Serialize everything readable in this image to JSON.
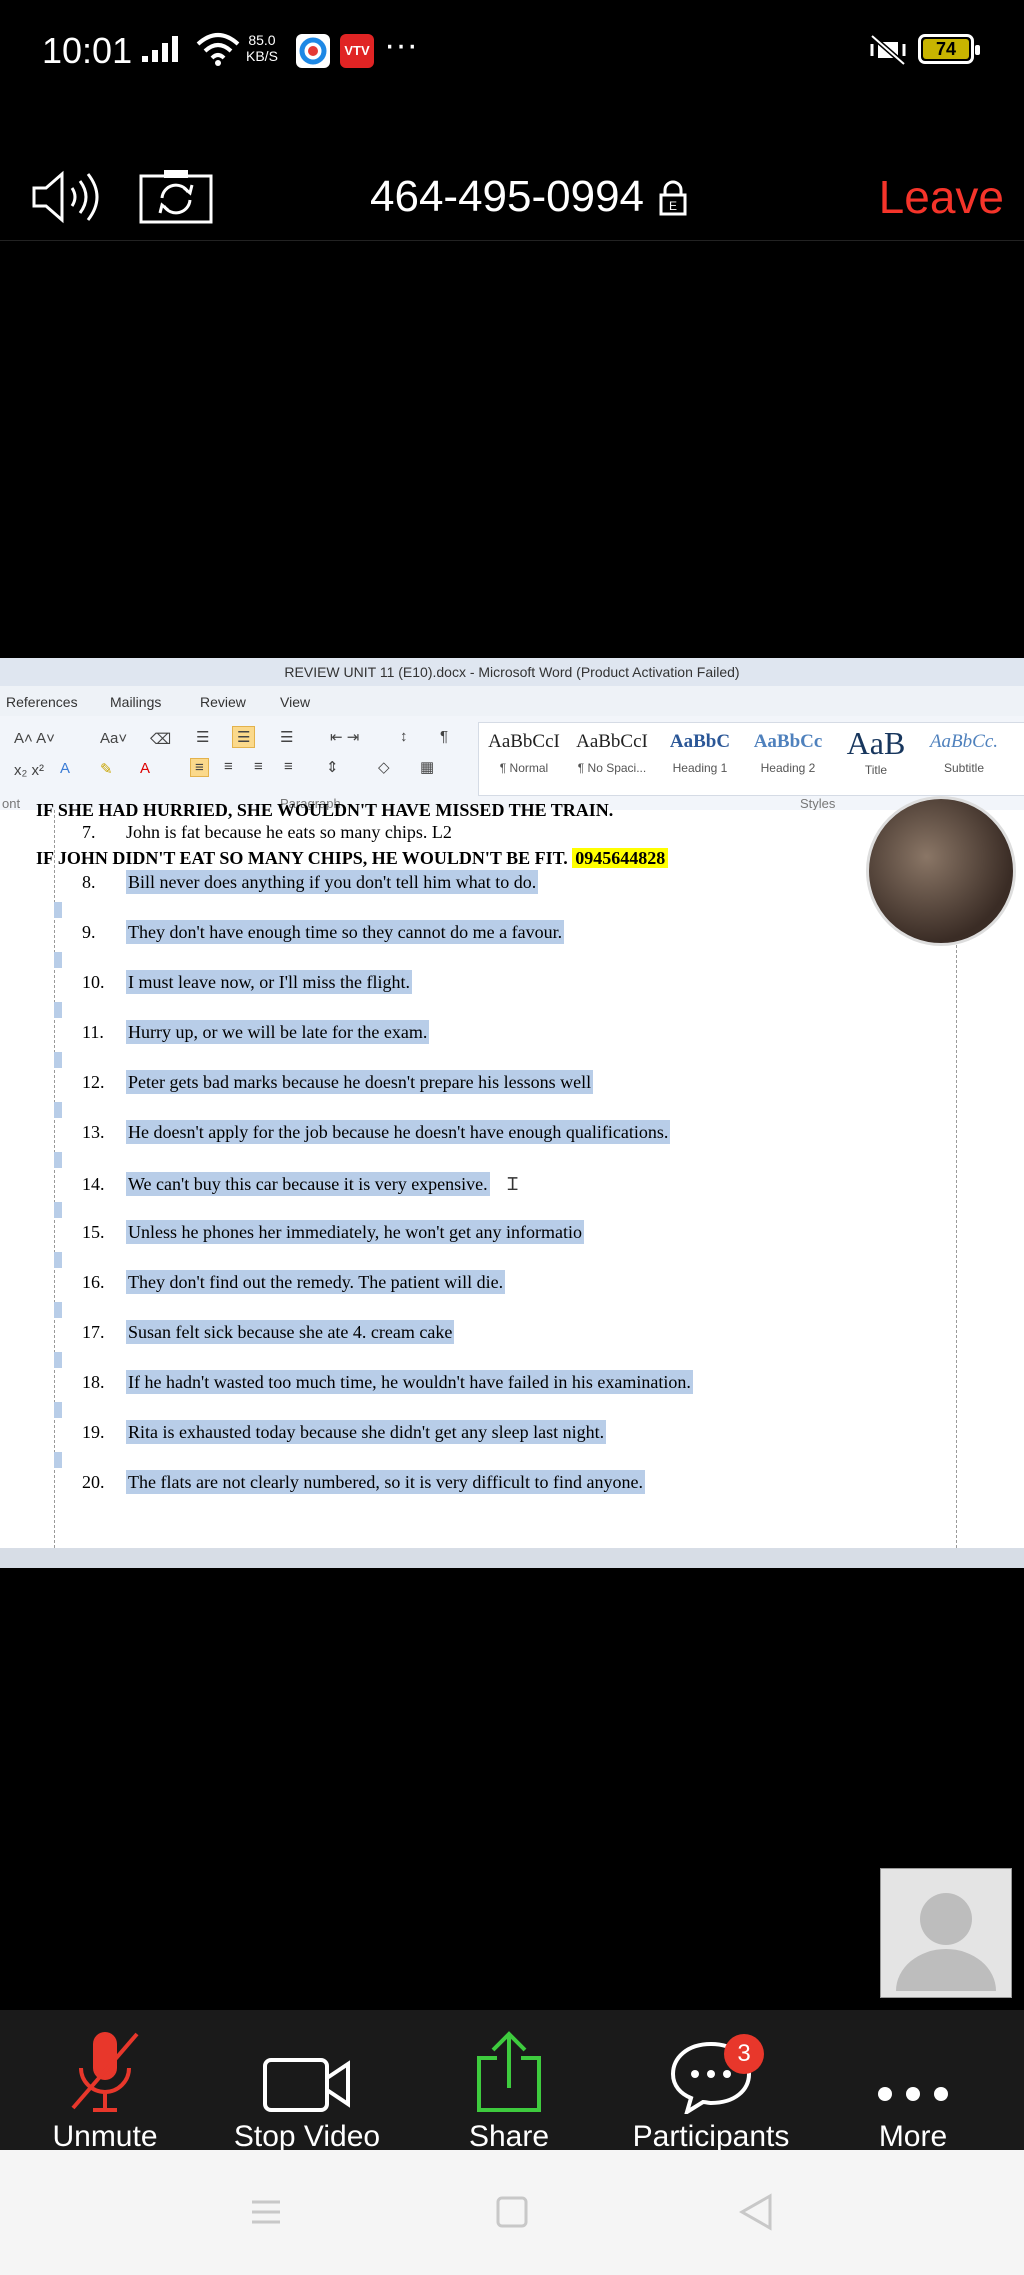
{
  "status_bar": {
    "time": "10:01",
    "net_speed_value": "85.0",
    "net_speed_unit": "KB/S",
    "more": "···",
    "battery": "74"
  },
  "meeting": {
    "meeting_id": "464-495-0994",
    "leave_label": "Leave"
  },
  "word": {
    "title": "REVIEW UNIT 11 (E10).docx - Microsoft Word (Product Activation Failed)",
    "tabs": [
      "References",
      "Mailings",
      "Review",
      "View"
    ],
    "groups": {
      "paragraph": "Paragraph",
      "styles": "Styles",
      "font_partial": "ont"
    },
    "styles": [
      {
        "sample": "AaBbCcI",
        "label": "¶ Normal"
      },
      {
        "sample": "AaBbCcI",
        "label": "¶ No Spaci..."
      },
      {
        "sample": "AaBbC",
        "label": "Heading 1"
      },
      {
        "sample": "AaBbCc",
        "label": "Heading 2"
      },
      {
        "sample": "AaB",
        "label": "Title"
      },
      {
        "sample": "AaBbCc.",
        "label": "Subtitle"
      }
    ],
    "cut_line": "IF SHE HAD HURRIED, SHE WOULDN'T HAVE MISSED THE TRAIN.",
    "line7_num": "7.",
    "line7": "John is fat because he eats so many chips. L2",
    "answer": "IF JOHN DIDN'T EAT SO MANY CHIPS, HE WOULDN'T  BE FIT.",
    "phone": "0945644828",
    "items": [
      {
        "num": "8.",
        "text": "Bill never does anything if you don't tell him what to do."
      },
      {
        "num": "9.",
        "text": "They don't have enough time so they cannot do me a favour."
      },
      {
        "num": "10.",
        "text": "I must leave now, or I'll miss the flight."
      },
      {
        "num": "11.",
        "text": "Hurry up, or we will be late for the exam."
      },
      {
        "num": "12.",
        "text": "Peter gets bad marks because he doesn't prepare his lessons well"
      },
      {
        "num": "13.",
        "text": "He doesn't apply for the job because he doesn't have enough qualifications."
      },
      {
        "num": "14.",
        "text": "We can't buy this car because it is very expensive."
      },
      {
        "num": "15.",
        "text": "Unless he phones her immediately, he won't get any informatio"
      },
      {
        "num": "16.",
        "text": "They don't find out the remedy. The patient will die."
      },
      {
        "num": "17.",
        "text": "Susan felt sick because she ate 4. cream cake"
      },
      {
        "num": "18.",
        "text": "If he hadn't wasted too much time, he wouldn't have failed in his examination."
      },
      {
        "num": "19.",
        "text": "Rita is exhausted today because she didn't get any sleep last night."
      },
      {
        "num": "20.",
        "text": "The flats are not clearly numbered, so it is very difficult to find anyone."
      }
    ]
  },
  "toolbar": {
    "unmute": "Unmute",
    "stop_video": "Stop Video",
    "share": "Share",
    "participants": "Participants",
    "participants_badge": "3",
    "more": "More"
  }
}
